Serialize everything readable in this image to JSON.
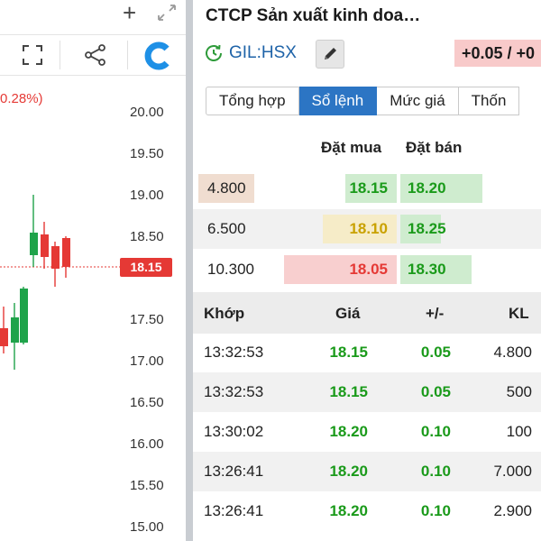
{
  "chart_panel": {
    "percent_change": "0.28%)",
    "axis_labels": [
      "20.00",
      "19.50",
      "19.00",
      "18.50",
      "18.00",
      "17.50",
      "17.00",
      "16.50",
      "16.00",
      "15.50",
      "15.00"
    ],
    "current_price_tag": "18.15",
    "up_color": "#1fa34a",
    "down_color": "#e53935",
    "logo_color": "#1e90e6"
  },
  "header": {
    "company_name": "CTCP Sản xuất kinh doa…",
    "ticker": "GIL:HSX",
    "change": "+0.05 / +0"
  },
  "tabs": [
    {
      "label": "Tổng hợp",
      "active": false
    },
    {
      "label": "Sổ lệnh",
      "active": true
    },
    {
      "label": "Mức giá",
      "active": false
    },
    {
      "label": "Thốn",
      "active": false
    }
  ],
  "order_book": {
    "bid_header": "Đặt mua",
    "ask_header": "Đặt bán",
    "rows": [
      {
        "volume": "4.800",
        "volume_fill": 0.35,
        "bid": "18.15",
        "bid_color": "#1a9a1a",
        "bid_bg": "#cfeccf",
        "bid_fill": 0.45,
        "ask": "18.20",
        "ask_fill": 0.67
      },
      {
        "volume": "6.500",
        "volume_fill": 0,
        "bid": "18.10",
        "bid_color": "#c9a100",
        "bid_bg": "#f6ecc8",
        "bid_fill": 0.65,
        "ask": "18.25",
        "ask_fill": 0.33
      },
      {
        "volume": "10.300",
        "volume_fill": 0,
        "bid": "18.05",
        "bid_color": "#e53935",
        "bid_bg": "#f8cfcf",
        "bid_fill": 0.99,
        "ask": "18.30",
        "ask_fill": 0.58
      }
    ]
  },
  "trades": {
    "headers": {
      "time": "Khớp",
      "price": "Giá",
      "change": "+/-",
      "volume": "KL"
    },
    "rows": [
      {
        "time": "13:32:53",
        "price": "18.15",
        "change": "0.05",
        "volume": "4.800"
      },
      {
        "time": "13:32:53",
        "price": "18.15",
        "change": "0.05",
        "volume": "500"
      },
      {
        "time": "13:30:02",
        "price": "18.20",
        "change": "0.10",
        "volume": "100"
      },
      {
        "time": "13:26:41",
        "price": "18.20",
        "change": "0.10",
        "volume": "7.000"
      },
      {
        "time": "13:26:41",
        "price": "18.20",
        "change": "0.10",
        "volume": "2.900"
      }
    ]
  }
}
